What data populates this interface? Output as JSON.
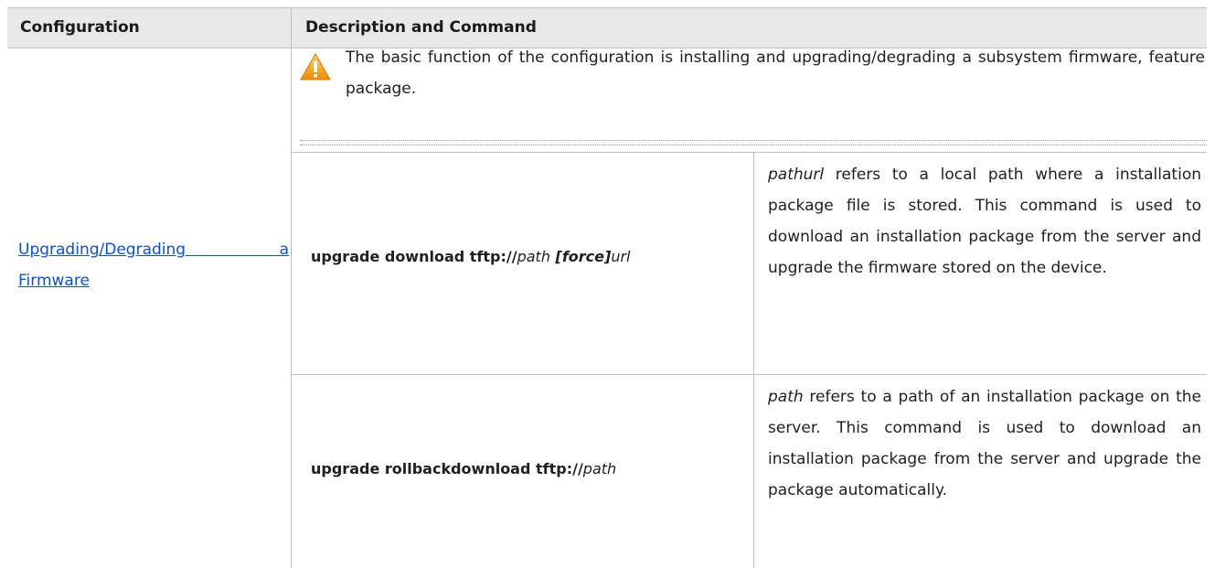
{
  "table": {
    "headers": [
      "Configuration",
      "Description and Command"
    ],
    "configuration_link": [
      "Upgrading/Degrading a",
      "Firmware"
    ],
    "warning_text": "The basic function of the configuration is installing and upgrading/degrading a subsystem firmware, feature package.",
    "icons": {
      "warning": "warning-triangle-icon"
    },
    "colors": {
      "header_bg": "#e8e8e8",
      "link": "#0b4fd8",
      "warning_fill": "#f5a623",
      "border": "#bfbfbf"
    },
    "rows": [
      {
        "cmd_bold": "upgrade download tftp://",
        "cmd_path": "path",
        "cmd_force": " [force]",
        "cmd_url": "url",
        "desc_param": "pathurl",
        "desc_text": " refers to a local path where a installation package file is stored. This command is used to download an installation package from the server and upgrade the firmware stored on the device."
      },
      {
        "cmd_bold": "upgrade rollbackdownload tftp://",
        "cmd_path": "path",
        "desc_param": "path",
        "desc_text": " refers to a path of an installation package on the server. This command is used to download an installation package from the server and upgrade the package automatically."
      }
    ]
  }
}
